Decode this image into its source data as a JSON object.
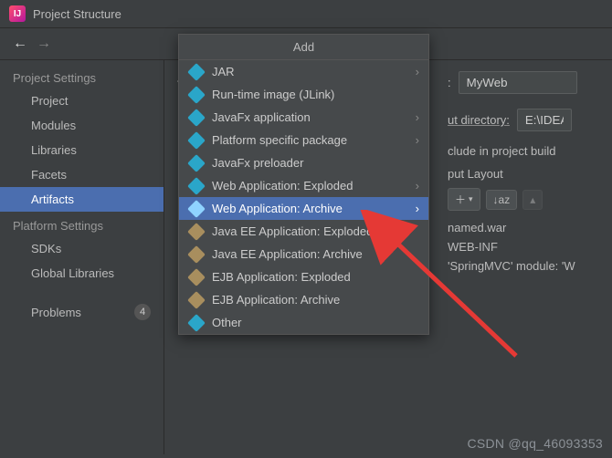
{
  "titlebar": {
    "title": "Project Structure"
  },
  "sidebar": {
    "group1": "Project Settings",
    "items1": [
      "Project",
      "Modules",
      "Libraries",
      "Facets",
      "Artifacts"
    ],
    "group2": "Platform Settings",
    "items2": [
      "SDKs",
      "Global Libraries"
    ],
    "problems": "Problems",
    "problems_count": "4"
  },
  "content": {
    "name_colon": ":",
    "name_value": "MyWeb",
    "output_dir_label": "ut directory:",
    "output_dir_value": "E:\\IDEAd",
    "include_label": "clude in project build",
    "layout_label": "put Layout",
    "sort_label": "↓az",
    "tree": {
      "root": "named.war",
      "folder": "WEB-INF",
      "module": "'SpringMVC' module: 'W"
    }
  },
  "popup": {
    "title": "Add",
    "items": [
      {
        "label": "JAR",
        "sub": true,
        "d": "blue"
      },
      {
        "label": "Run-time image (JLink)",
        "sub": false,
        "d": "blue"
      },
      {
        "label": "JavaFx application",
        "sub": true,
        "d": "blue"
      },
      {
        "label": "Platform specific package",
        "sub": true,
        "d": "blue"
      },
      {
        "label": "JavaFx preloader",
        "sub": false,
        "d": "blue"
      },
      {
        "label": "Web Application: Exploded",
        "sub": true,
        "d": "blue"
      },
      {
        "label": "Web Application: Archive",
        "sub": true,
        "d": "blue",
        "hl": true
      },
      {
        "label": "Java EE Application: Exploded",
        "sub": false,
        "d": "brown"
      },
      {
        "label": "Java EE Application: Archive",
        "sub": false,
        "d": "brown"
      },
      {
        "label": "EJB Application: Exploded",
        "sub": false,
        "d": "brown"
      },
      {
        "label": "EJB Application: Archive",
        "sub": false,
        "d": "brown"
      },
      {
        "label": "Other",
        "sub": false,
        "d": "blue"
      }
    ]
  },
  "watermark": "CSDN @qq_46093353"
}
